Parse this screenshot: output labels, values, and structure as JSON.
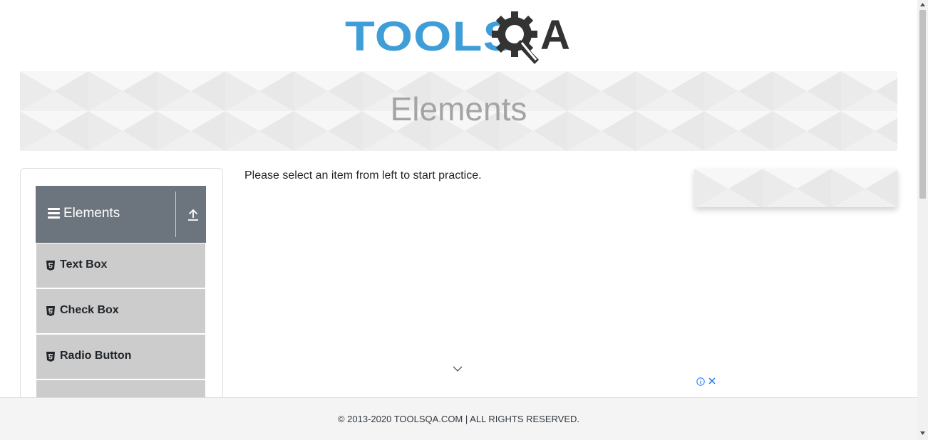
{
  "header": {
    "logo": {
      "text_blue": "TOOLS",
      "text_dark": "A",
      "alt": "TOOLSQA"
    }
  },
  "banner": {
    "title": "Elements"
  },
  "sidebar": {
    "group": {
      "title": "Elements",
      "icons": [
        "hamburger-icon",
        "collapse-up-icon"
      ]
    },
    "items": [
      {
        "label": "Text Box",
        "icon": "html5-icon"
      },
      {
        "label": "Check Box",
        "icon": "html5-icon"
      },
      {
        "label": "Radio Button",
        "icon": "html5-icon"
      },
      {
        "label": "",
        "icon": ""
      }
    ]
  },
  "main": {
    "message": "Please select an item from left to start practice."
  },
  "ad": {
    "icons": [
      "info-icon",
      "close-icon",
      "chevron-down-icon"
    ]
  },
  "footer": {
    "text": "© 2013-2020 TOOLSQA.COM | ALL RIGHTS RESERVED."
  },
  "colors": {
    "brand_blue": "#3f9ed7",
    "brand_dark": "#333333",
    "group_header": "#6c757d",
    "menu_item": "#cccccc",
    "banner_title": "#a4a4a4",
    "ad_icon": "#1a73e8"
  }
}
